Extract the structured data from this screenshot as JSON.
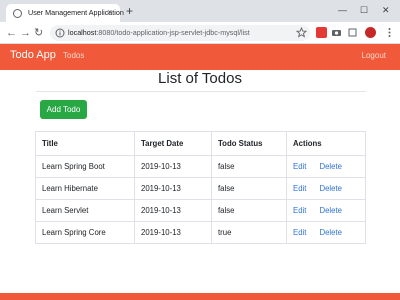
{
  "browser": {
    "tab_title": "User Management Application",
    "tab_close": "×",
    "new_tab": "+",
    "url_host": "localhost",
    "url_rest": ":8080/todo-application-jsp-servlet-jdbc-mysql/list",
    "window_controls": {
      "minimize": "—",
      "maximize": "☐",
      "close": "✕"
    },
    "nav": {
      "back": "←",
      "forward": "→",
      "reload": "↻"
    },
    "toolbar_icons": [
      "star-icon",
      "extension-icon",
      "camera-icon",
      "puzzle-icon",
      "profile-avatar-icon",
      "menu-icon"
    ]
  },
  "navbar": {
    "brand": "Todo App",
    "link": "Todos",
    "logout": "Logout",
    "color": "#f05a3a"
  },
  "main": {
    "title": "List of Todos",
    "add_button": "Add Todo",
    "add_button_color": "#28a745"
  },
  "table": {
    "headers": [
      "Title",
      "Target Date",
      "Todo Status",
      "Actions"
    ],
    "rows": [
      {
        "title": "Learn Spring Boot",
        "date": "2019-10-13",
        "status": "false",
        "edit": "Edit",
        "delete": "Delete"
      },
      {
        "title": "Learn Hibernate",
        "date": "2019-10-13",
        "status": "false",
        "edit": "Edit",
        "delete": "Delete"
      },
      {
        "title": "Learn Servlet",
        "date": "2019-10-13",
        "status": "false",
        "edit": "Edit",
        "delete": "Delete"
      },
      {
        "title": "Learn Spring Core",
        "date": "2019-10-13",
        "status": "true",
        "edit": "Edit",
        "delete": "Delete"
      }
    ]
  }
}
